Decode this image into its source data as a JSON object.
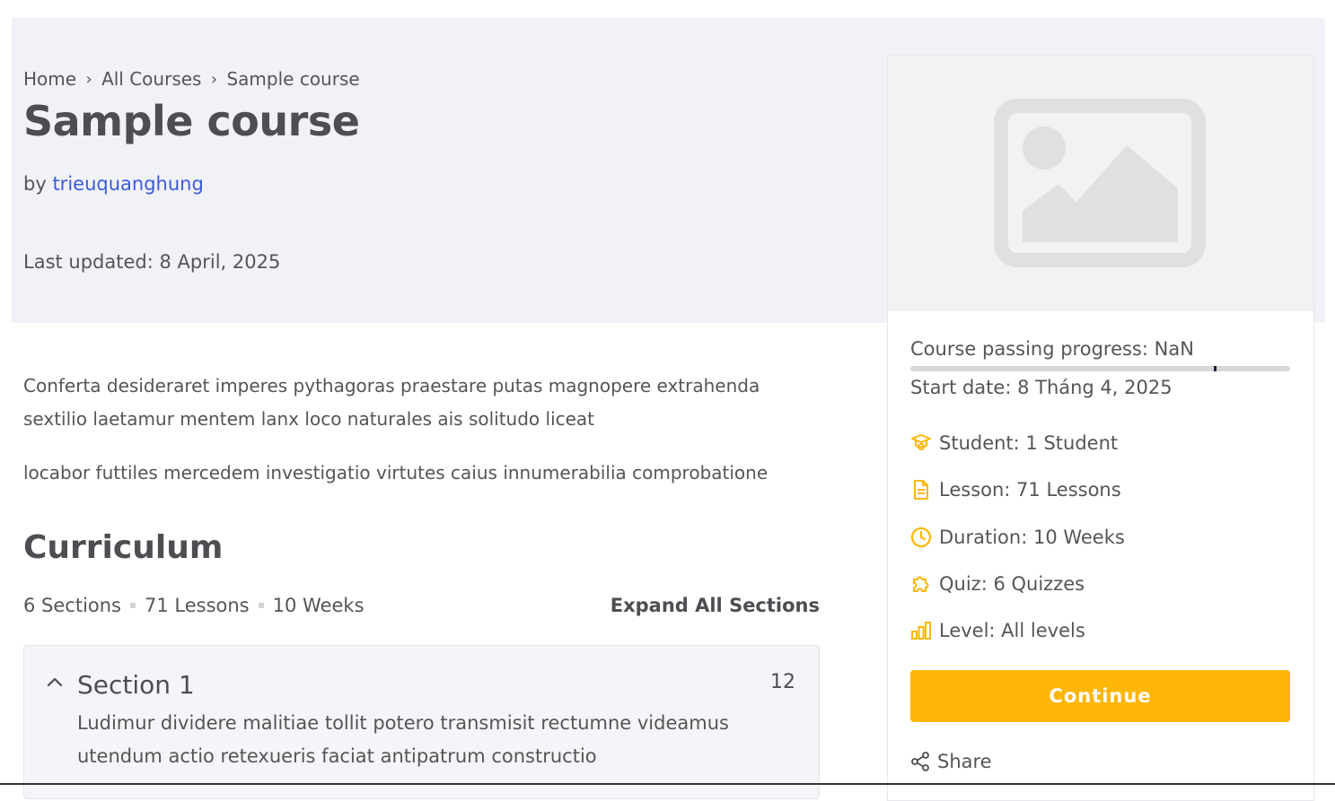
{
  "breadcrumb": {
    "home": "Home",
    "all_courses": "All Courses",
    "current": "Sample course"
  },
  "course": {
    "title": "Sample course",
    "by_prefix": "by",
    "author": "trieuquanghung",
    "last_updated": "Last updated: 8 April, 2025",
    "description": [
      "Conferta desideraret imperes pythagoras praestare putas magnopere extrahenda sextilio laetamur mentem lanx loco naturales ais solitudo liceat",
      "locabor futtiles mercedem investigatio virtutes caius innumerabilia comprobatione"
    ]
  },
  "curriculum": {
    "title": "Curriculum",
    "sections_count": "6 Sections",
    "lessons_count": "71 Lessons",
    "duration": "10 Weeks",
    "expand_label": "Expand All Sections",
    "sections": [
      {
        "title": "Section 1",
        "count": "12",
        "description": "Ludimur dividere malitiae tollit potero transmisit rectumne videamus utendum actio retexueris faciat antipatrum constructio"
      }
    ]
  },
  "sidebar": {
    "thumbnail_icon": "image-placeholder-icon",
    "progress_label": "Course passing progress: NaN",
    "start_date": "Start date: 8 Tháng 4, 2025",
    "meta": {
      "student": "Student: 1 Student",
      "lesson": "Lesson: 71 Lessons",
      "duration": "Duration: 10 Weeks",
      "quiz": "Quiz: 6 Quizzes",
      "level": "Level: All levels"
    },
    "continue_label": "Continue",
    "share_label": "Share"
  },
  "colors": {
    "hero_bg": "#f1f2f8",
    "accent": "#ffb606",
    "link": "#3b5bdb",
    "progress_track": "#d8d8db",
    "progress_marker": "#1e2235"
  }
}
